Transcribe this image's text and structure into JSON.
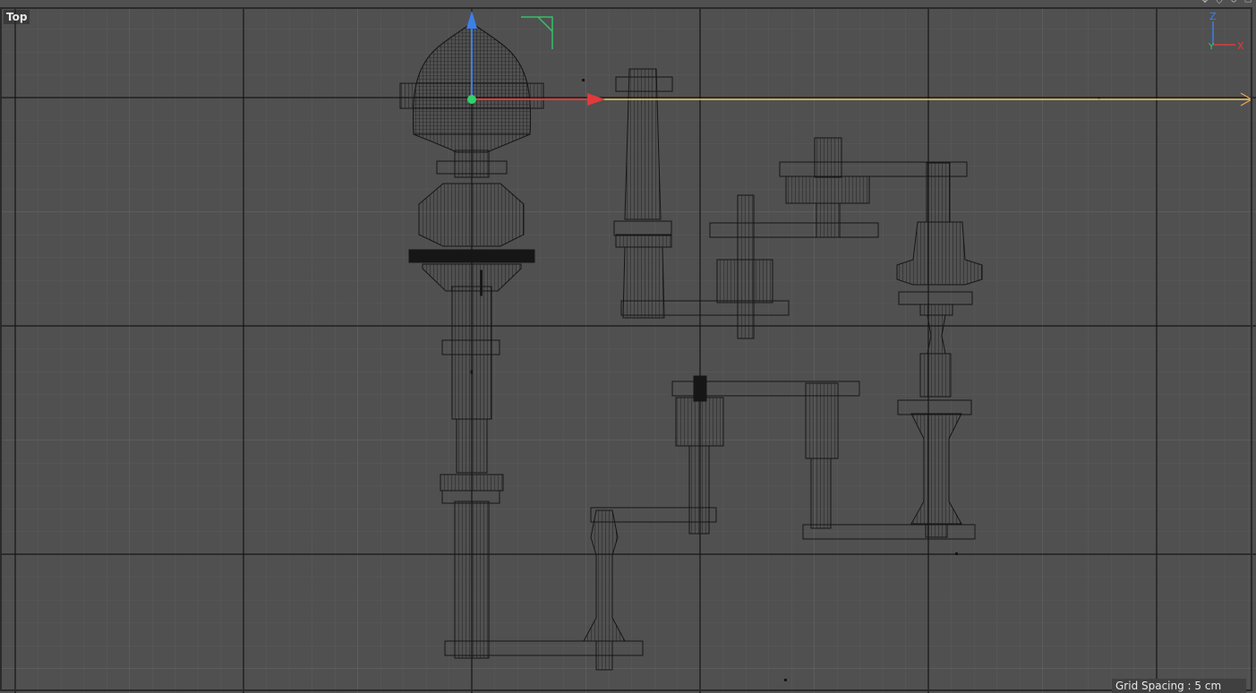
{
  "viewport": {
    "view_name": "Top",
    "grid_spacing_label": "Grid Spacing : 5 cm"
  },
  "axis_gizmo": {
    "z_label": "Z",
    "x_label": "X",
    "y_label": "Y"
  },
  "corner_icons": [
    "move-view-icon",
    "zoom-view-icon",
    "rotate-view-icon",
    "toggle-layout-icon"
  ],
  "colors": {
    "background": "#505050",
    "minor_grid": "#5a5a5a",
    "major_grid": "#161616",
    "wire": "#161616",
    "x_axis": "#e23a3a",
    "z_axis": "#3d7fe8",
    "object_origin": "#2fd36a",
    "selection_corner": "#36c06a",
    "motion_path": "#e8c560"
  }
}
